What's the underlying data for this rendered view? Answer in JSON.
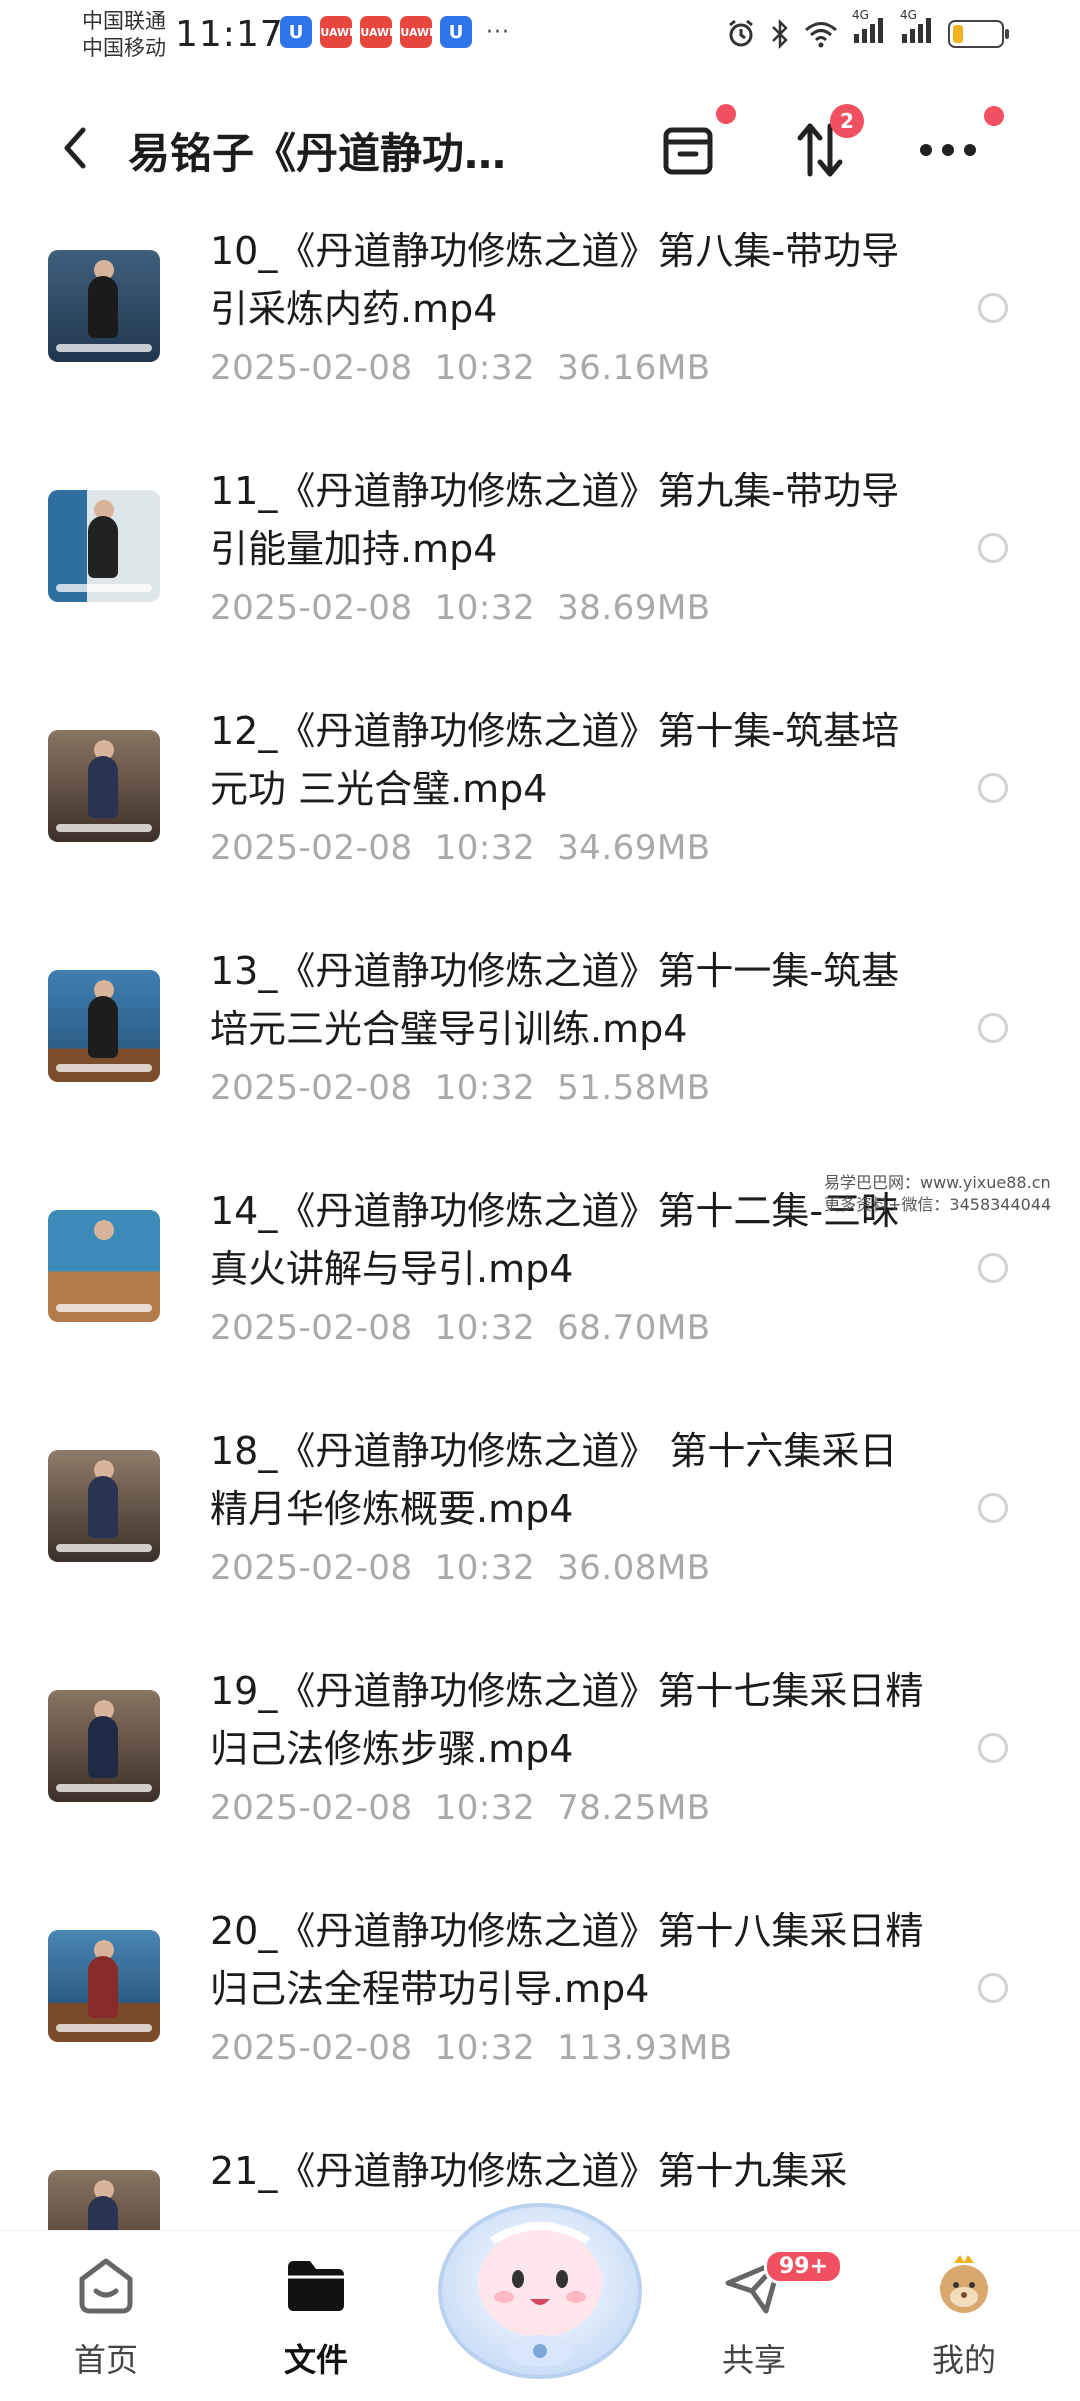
{
  "status_bar": {
    "carrier_1": "中国联通",
    "carrier_2": "中国移动",
    "time": "11:17",
    "more": "···",
    "notif_label": "HUAWEI",
    "notif_u": "U",
    "network": "4G",
    "battery_level": 0.22
  },
  "header": {
    "title": "易铭子《丹道静功…",
    "sort_badge_count": "2"
  },
  "files": [
    {
      "name": "10_《丹道静功修炼之道》第八集-带功导引采炼内药.mp4",
      "date": "2025-02-08",
      "time": "10:32",
      "size": "36.16MB"
    },
    {
      "name": "11_《丹道静功修炼之道》第九集-带功导引能量加持.mp4",
      "date": "2025-02-08",
      "time": "10:32",
      "size": "38.69MB"
    },
    {
      "name": "12_《丹道静功修炼之道》第十集-筑基培元功 三光合璧.mp4",
      "date": "2025-02-08",
      "time": "10:32",
      "size": "34.69MB"
    },
    {
      "name": "13_《丹道静功修炼之道》第十一集-筑基培元三光合璧导引训练.mp4",
      "date": "2025-02-08",
      "time": "10:32",
      "size": "51.58MB"
    },
    {
      "name": "14_《丹道静功修炼之道》第十二集-三昧真火讲解与导引.mp4",
      "date": "2025-02-08",
      "time": "10:32",
      "size": "68.70MB"
    },
    {
      "name": "18_《丹道静功修炼之道》 第十六集采日精月华修炼概要.mp4",
      "date": "2025-02-08",
      "time": "10:32",
      "size": "36.08MB"
    },
    {
      "name": "19_《丹道静功修炼之道》第十七集采日精归己法修炼步骤.mp4",
      "date": "2025-02-08",
      "time": "10:32",
      "size": "78.25MB"
    },
    {
      "name": "20_《丹道静功修炼之道》第十八集采日精归己法全程带功引导.mp4",
      "date": "2025-02-08",
      "time": "10:32",
      "size": "113.93MB"
    },
    {
      "name": "21_《丹道静功修炼之道》第十九集采",
      "date": "",
      "time": "",
      "size": ""
    }
  ],
  "watermark": {
    "line1": "易学巴巴网：www.yixue88.cn",
    "line2": "更多资料+微信：3458344044"
  },
  "bottom_nav": {
    "items": [
      {
        "label": "首页",
        "icon": "home-icon"
      },
      {
        "label": "文件",
        "icon": "folder-icon"
      },
      {
        "label": "共享",
        "icon": "send-icon"
      },
      {
        "label": "我的",
        "icon": "profile-avatar-icon"
      }
    ],
    "share_badge": "99+"
  },
  "colors": {
    "accent_badge": "#f0505f",
    "meta_text": "#a9a9a9",
    "battery": "#f2b11e"
  }
}
